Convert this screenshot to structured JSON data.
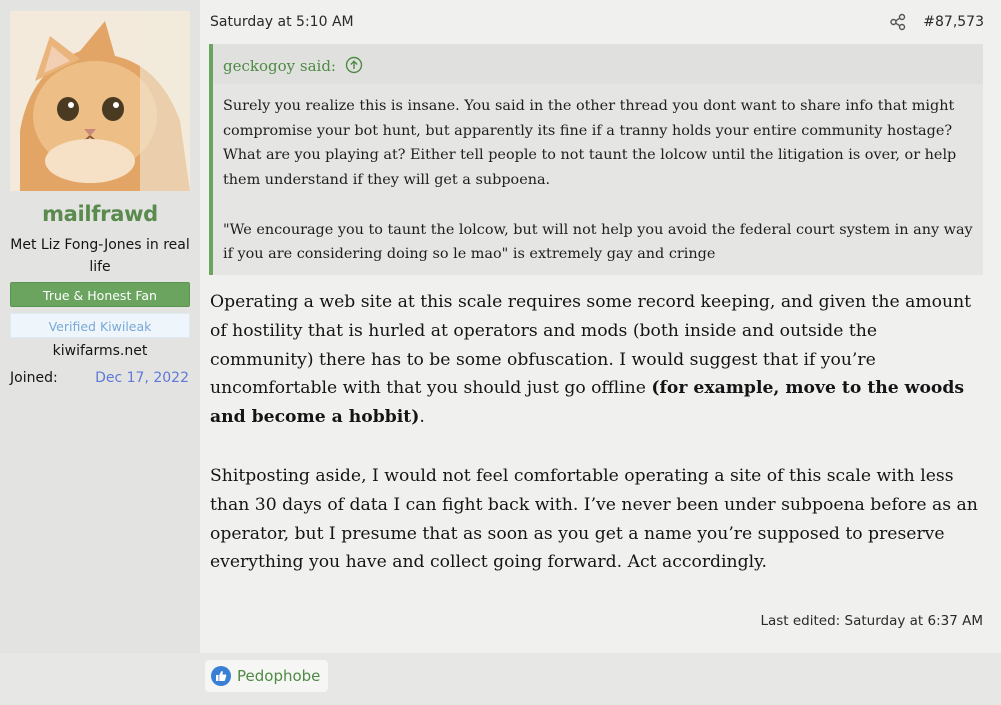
{
  "user": {
    "name": "mailfrawd",
    "title": "Met Liz Fong-Jones in real life",
    "banners": [
      "True & Honest Fan",
      "Verified Kiwileak"
    ],
    "site": "kiwifarms.net",
    "joined_label": "Joined:",
    "joined_value": "Dec 17, 2022"
  },
  "post": {
    "date": "Saturday at 5:10 AM",
    "number": "#87,573",
    "quote": {
      "author": "geckogoy said:",
      "paragraphs": [
        "Surely you realize this is insane. You said in the other thread you dont want to share info that might compromise your bot hunt, but apparently its fine if a tranny holds your entire community hostage? What are you playing at? Either tell people to not taunt the lolcow until the litigation is over, or help them understand if they will get a subpoena.",
        "\"We encourage you to taunt the lolcow, but will not help you avoid the federal court system in any way if you are considering doing so le mao\" is extremely gay and cringe"
      ]
    },
    "body": {
      "p1_text": "Operating a web site at this scale requires some record keeping, and given the amount of hostility that is hurled at operators and mods (both inside and outside the community) there has to be some obfuscation. I would suggest that if you’re uncomfortable with that you should just go offline ",
      "p1_bold": "(for example, move to the woods and become a hobbit)",
      "p1_end": ".",
      "p2": "Shitposting aside, I would not feel comfortable operating a site of this scale with less than 30 days of data I can fight back with. I’ve never been under subpoena before as an operator, but I presume that as soon as you get a name you’re supposed to preserve everything you have and collect going forward. Act accordingly."
    },
    "last_edited": "Last edited: Saturday at 6:37 AM"
  },
  "reaction": {
    "icon": "thumbs-up-icon",
    "label": "Pedophobe"
  },
  "colors": {
    "accent_green": "#6aa45f",
    "username_green": "#5a8a4e",
    "joined_date": "#6078d8",
    "verified_text": "#79a9d6"
  }
}
